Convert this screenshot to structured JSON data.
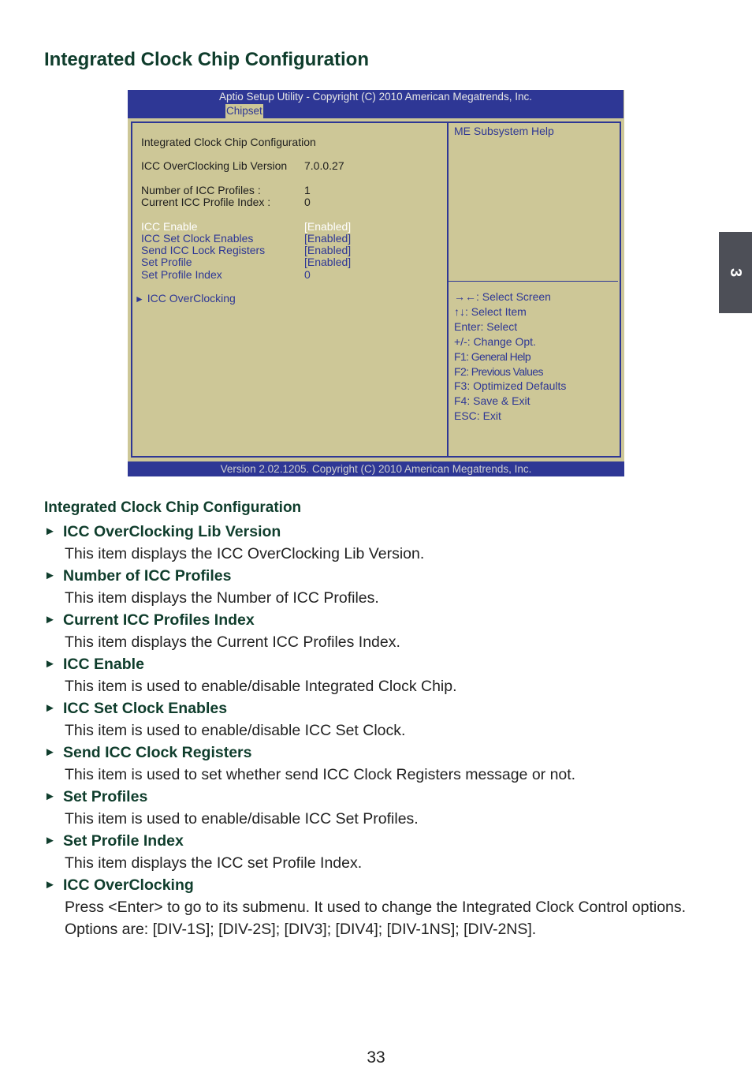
{
  "page": {
    "title": "Integrated Clock Chip Configuration",
    "chapter_tab": "3",
    "page_number": "33"
  },
  "bios": {
    "header_title": "Aptio Setup Utility - Copyright (C) 2010 American Megatrends, Inc.",
    "active_tab": "Chipset",
    "footer": "Version 2.02.1205. Copyright (C) 2010 American Megatrends, Inc.",
    "colors": {
      "frame_blue": "#2e3795",
      "panel_bg": "#cdc797",
      "selected_text": "#ffffff"
    },
    "section_title": "Integrated Clock Chip Configuration",
    "info": [
      {
        "label": "ICC OverClocking Lib Version",
        "value": "7.0.0.27"
      },
      {
        "label": "Number of ICC Profiles :",
        "value": "1"
      },
      {
        "label": "Current ICC Profile Index :",
        "value": "0"
      }
    ],
    "options": [
      {
        "label": "ICC Enable",
        "value": "[Enabled]",
        "selected": true
      },
      {
        "label": "ICC Set Clock Enables",
        "value": "[Enabled]",
        "selected": false
      },
      {
        "label": "Send ICC Lock Registers",
        "value": "[Enabled]",
        "selected": false
      },
      {
        "label": "Set Profile",
        "value": "[Enabled]",
        "selected": false
      },
      {
        "label": "Set Profile Index",
        "value": "0",
        "selected": false
      }
    ],
    "submenu": {
      "icon": "►",
      "label": "ICC OverClocking"
    },
    "help_title": "ME Subsystem Help",
    "key_help": [
      "→←: Select Screen",
      "↑↓: Select Item",
      "Enter: Select",
      "+/-: Change Opt.",
      "F1:  General Help",
      "F2:  Previous Values",
      "F3: Optimized Defaults",
      "F4: Save & Exit",
      "ESC: Exit"
    ]
  },
  "description": {
    "title": "Integrated Clock Chip Configuration",
    "arrow_icon": "►",
    "items": [
      {
        "heading": "ICC OverClocking Lib Version",
        "body": [
          "This item displays the ICC OverClocking Lib Version."
        ]
      },
      {
        "heading": "Number of ICC Profiles",
        "body": [
          "This item displays the Number of ICC Profiles."
        ]
      },
      {
        "heading": "Current ICC Profiles Index",
        "body": [
          "This item displays the Current ICC Profiles Index."
        ]
      },
      {
        "heading": "ICC Enable",
        "body": [
          "This item is used to enable/disable Integrated Clock Chip."
        ]
      },
      {
        "heading": "ICC Set Clock Enables",
        "body": [
          "This item is used to enable/disable ICC Set Clock."
        ]
      },
      {
        "heading": "Send ICC Clock Registers",
        "body": [
          "This item is used to set whether send ICC Clock Registers message or not."
        ]
      },
      {
        "heading": "Set Profiles",
        "body": [
          "This item is used to enable/disable ICC Set Profiles."
        ]
      },
      {
        "heading": "Set Profile Index",
        "body": [
          "This item displays the ICC set Profile Index."
        ]
      },
      {
        "heading": "ICC OverClocking",
        "body": [
          "Press <Enter> to go to its submenu.  It used to change the Integrated Clock Control options.",
          "Options are: [DIV-1S]; [DIV-2S]; [DIV3]; [DIV4]; [DIV-1NS]; [DIV-2NS]."
        ]
      }
    ]
  }
}
